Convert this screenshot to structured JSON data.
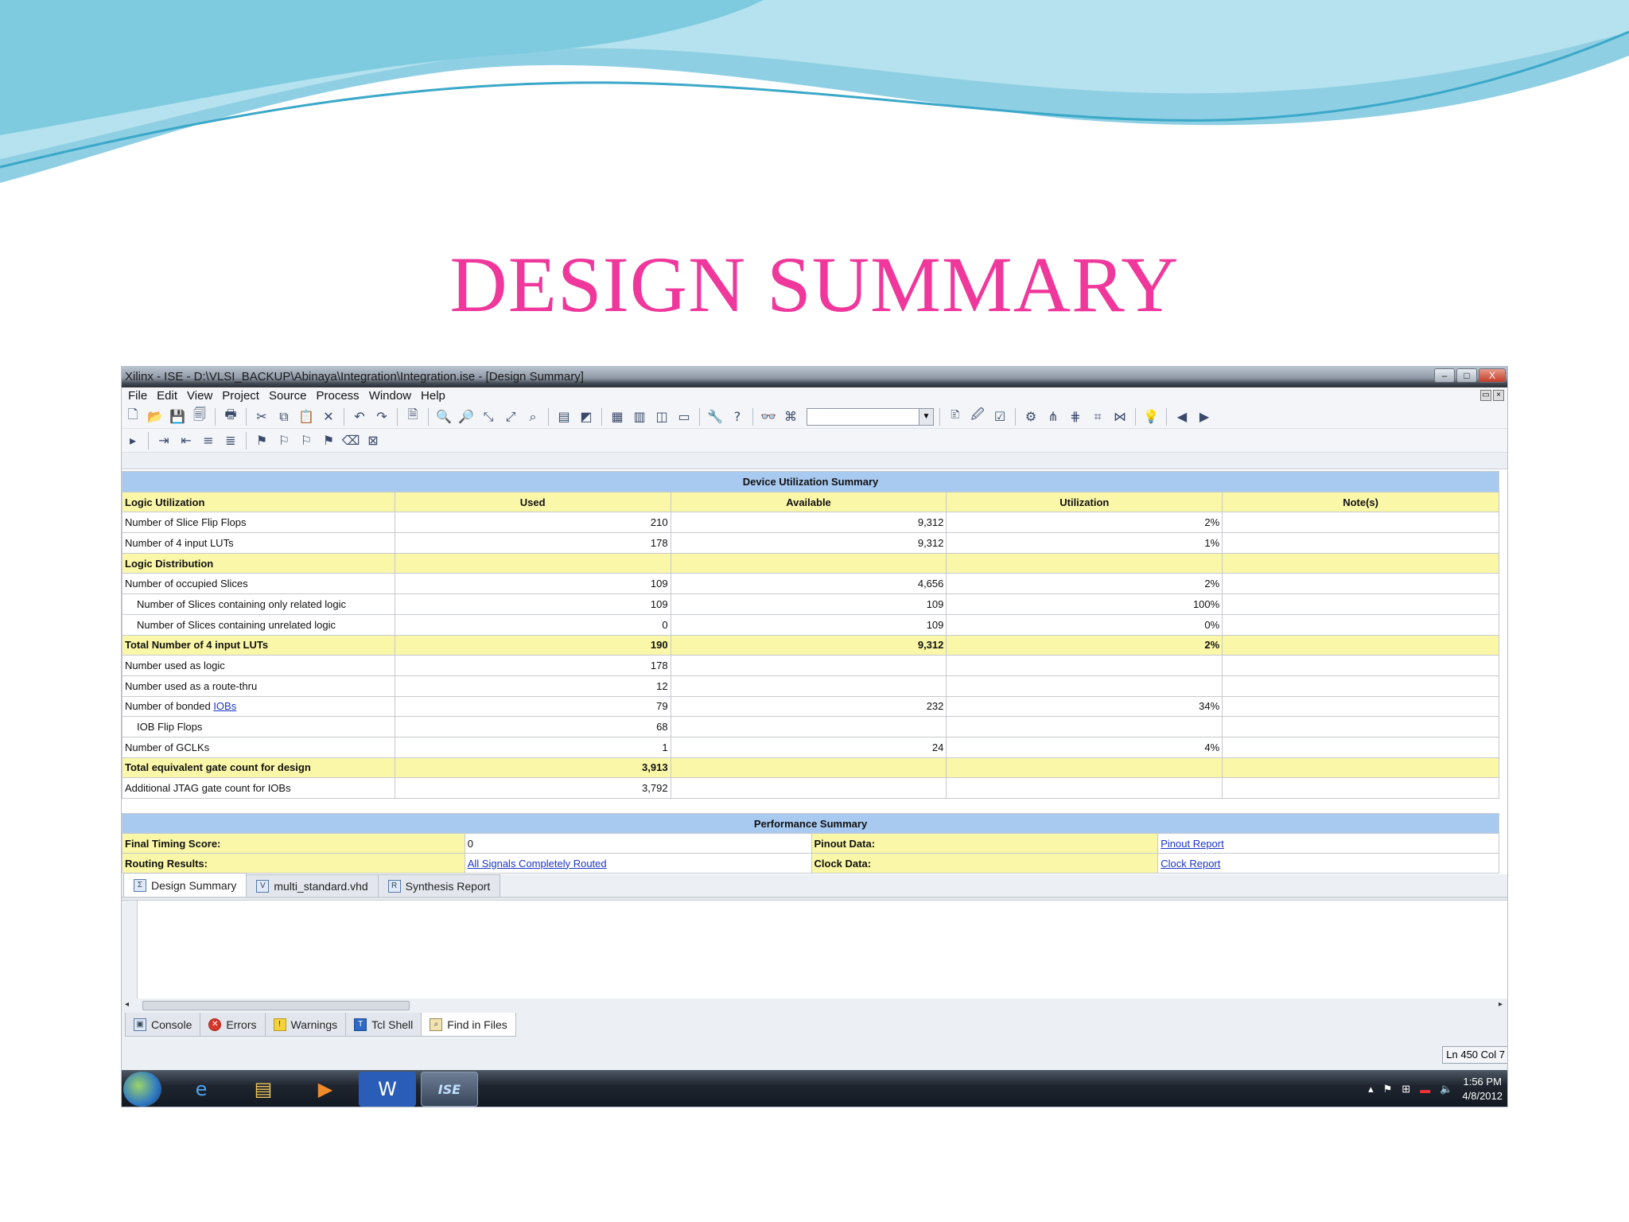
{
  "slide": {
    "title": "DESIGN SUMMARY"
  },
  "window": {
    "title": "Xilinx - ISE - D:\\VLSI_BACKUP\\Abinaya\\Integration\\Integration.ise - [Design Summary]",
    "controls": {
      "minimize": "–",
      "maximize": "□",
      "close": "X"
    }
  },
  "menu": [
    "File",
    "Edit",
    "View",
    "Project",
    "Source",
    "Process",
    "Window",
    "Help"
  ],
  "device_summary": {
    "title": "Device Utilization Summary",
    "columns": [
      "Logic Utilization",
      "Used",
      "Available",
      "Utilization",
      "Note(s)"
    ],
    "rows": [
      {
        "label": "Number of Slice Flip Flops",
        "used": "210",
        "available": "9,312",
        "util": "2%",
        "style": "normal"
      },
      {
        "label": "Number of 4 input LUTs",
        "used": "178",
        "available": "9,312",
        "util": "1%",
        "style": "normal"
      },
      {
        "label": "Logic Distribution",
        "used": "",
        "available": "",
        "util": "",
        "style": "section"
      },
      {
        "label": "Number of occupied Slices",
        "used": "109",
        "available": "4,656",
        "util": "2%",
        "style": "normal"
      },
      {
        "label": "Number of Slices containing only related logic",
        "used": "109",
        "available": "109",
        "util": "100%",
        "style": "indent"
      },
      {
        "label": "Number of Slices containing unrelated logic",
        "used": "0",
        "available": "109",
        "util": "0%",
        "style": "indent"
      },
      {
        "label": "Total Number of 4 input LUTs",
        "used": "190",
        "available": "9,312",
        "util": "2%",
        "style": "section"
      },
      {
        "label": "Number used as logic",
        "used": "178",
        "available": "",
        "util": "",
        "style": "normal"
      },
      {
        "label": "Number used as a route-thru",
        "used": "12",
        "available": "",
        "util": "",
        "style": "normal"
      },
      {
        "label": "Number of bonded",
        "link": "IOBs",
        "used": "79",
        "available": "232",
        "util": "34%",
        "style": "normal"
      },
      {
        "label": "IOB Flip Flops",
        "used": "68",
        "available": "",
        "util": "",
        "style": "indent"
      },
      {
        "label": "Number of GCLKs",
        "used": "1",
        "available": "24",
        "util": "4%",
        "style": "normal"
      },
      {
        "label": "Total equivalent gate count for design",
        "used": "3,913",
        "available": "",
        "util": "",
        "style": "section"
      },
      {
        "label": "Additional JTAG gate count for IOBs",
        "used": "3,792",
        "available": "",
        "util": "",
        "style": "normal"
      }
    ]
  },
  "performance_summary": {
    "title": "Performance Summary",
    "final_timing_label": "Final Timing Score:",
    "final_timing_value": "0",
    "routing_label": "Routing Results:",
    "routing_value": "All Signals Completely Routed",
    "pinout_label": "Pinout Data:",
    "pinout_value": "Pinout Report",
    "clock_label": "Clock Data:",
    "clock_value": "Clock Report"
  },
  "doc_tabs": [
    "Design Summary",
    "multi_standard.vhd",
    "Synthesis Report"
  ],
  "bottom_tabs": [
    "Console",
    "Errors",
    "Warnings",
    "Tcl Shell",
    "Find in Files"
  ],
  "status": {
    "position": "Ln 450 Col 7"
  },
  "taskbar": {
    "time": "1:56 PM",
    "date": "4/8/2012",
    "active_app": "ISE"
  },
  "colors": {
    "title_pink": "#f0379b",
    "header_blue": "#a8caf0",
    "row_yellow": "#fbf7a8",
    "link_blue": "#1b35c8"
  }
}
